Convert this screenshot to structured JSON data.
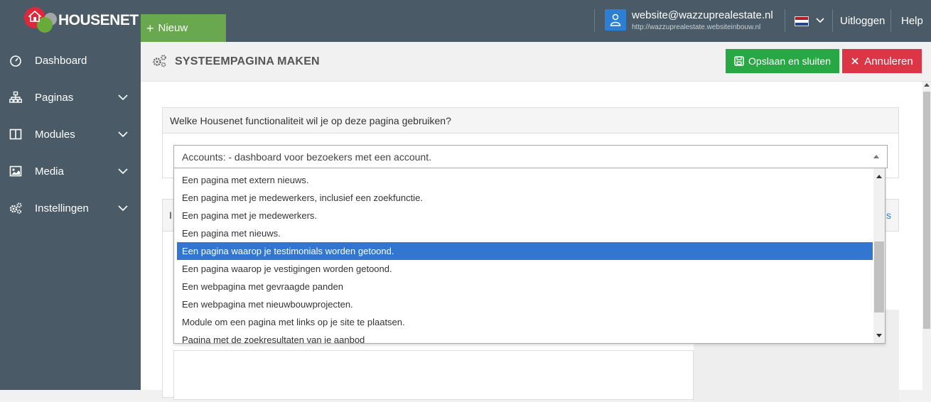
{
  "brand": {
    "name": "HOUSENET"
  },
  "topbar": {
    "new_label": "Nieuw",
    "user_email": "website@wazzuprealestate.nl",
    "user_url": "http://wazzuprealestate.websiteinbouw.nl",
    "logout_label": "Uitloggen",
    "help_label": "Help",
    "flag_colors": [
      "#ae1c28",
      "#ffffff",
      "#21468b"
    ]
  },
  "sidebar": {
    "items": [
      {
        "label": "Dashboard",
        "icon": "dashboard-icon",
        "has_children": false
      },
      {
        "label": "Paginas",
        "icon": "sitemap-icon",
        "has_children": true
      },
      {
        "label": "Modules",
        "icon": "columns-icon",
        "has_children": true
      },
      {
        "label": "Media",
        "icon": "image-icon",
        "has_children": true
      },
      {
        "label": "Instellingen",
        "icon": "gears-icon",
        "has_children": true
      }
    ]
  },
  "header": {
    "title": "SYSTEEMPAGINA MAKEN",
    "save_label": "Opslaan en sluiten",
    "cancel_label": "Annuleren"
  },
  "panel1": {
    "question": "Welke Housenet functionaliteit wil je op deze pagina gebruiken?",
    "selected_value": "Accounts: - dashboard voor bezoekers met een account."
  },
  "panel2": {
    "head_letter": "I",
    "head_link": "s"
  },
  "dropdown": {
    "selected_index": 4,
    "options": [
      "Een pagina met extern nieuws.",
      "Een pagina met je medewerkers, inclusief een zoekfunctie.",
      "Een pagina met je medewerkers.",
      "Een pagina met nieuws.",
      "Een pagina waarop je testimonials worden getoond.",
      "Een pagina waarop je vestigingen worden getoond.",
      "Een webpagina met gevraagde panden",
      "Een webpagina met nieuwbouwprojecten.",
      "Module om een pagina met links op je site te plaatsen.",
      "Pagina met de zoekresultaten van je aanbod"
    ]
  },
  "colors": {
    "sidebar_bg": "#4a5b67",
    "new_btn": "#6aa84f",
    "save_btn": "#28a745",
    "cancel_btn": "#dc3545",
    "selection": "#3276d2",
    "user_icon_bg": "#2d7fd6"
  }
}
